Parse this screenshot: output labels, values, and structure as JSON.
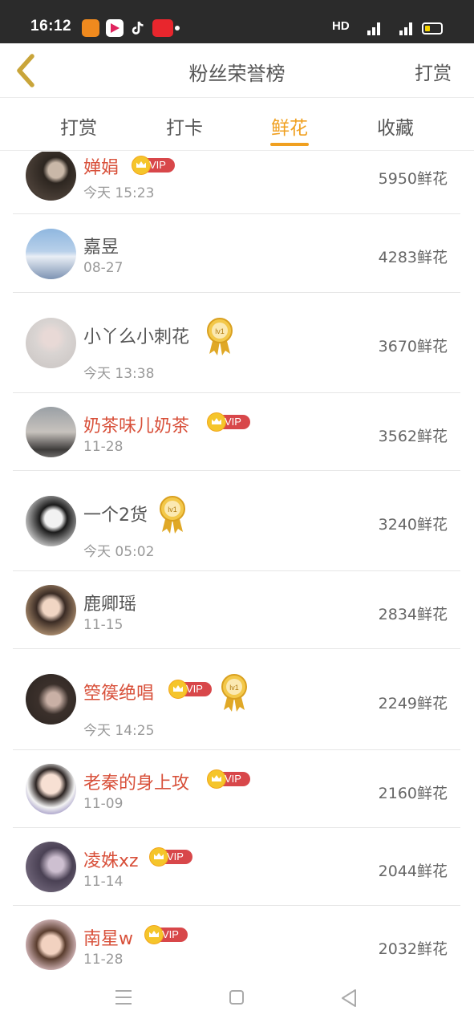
{
  "status_bar": {
    "time": "16:12",
    "network": "HD",
    "signal1": "4G",
    "signal2": "4G"
  },
  "header": {
    "title": "粉丝荣誉榜",
    "right_action": "打赏"
  },
  "tabs": [
    {
      "label": "打赏",
      "active": false
    },
    {
      "label": "打卡",
      "active": false
    },
    {
      "label": "鲜花",
      "active": true
    },
    {
      "label": "收藏",
      "active": false
    }
  ],
  "vip_label": "VIP",
  "medal_label": "lv1",
  "list": [
    {
      "name": "婵娟",
      "date": "今天 15:23",
      "value": "5950鲜花",
      "vip": true,
      "medal": false
    },
    {
      "name": "嘉昱",
      "date": "08-27",
      "value": "4283鲜花",
      "vip": false,
      "medal": false
    },
    {
      "name": "小丫么小刺花",
      "date": "今天 13:38",
      "value": "3670鲜花",
      "vip": false,
      "medal": true
    },
    {
      "name": "奶茶味儿奶茶",
      "date": "11-28",
      "value": "3562鲜花",
      "vip": true,
      "medal": false
    },
    {
      "name": "一个2货",
      "date": "今天 05:02",
      "value": "3240鲜花",
      "vip": false,
      "medal": true
    },
    {
      "name": "鹿卿瑶",
      "date": "11-15",
      "value": "2834鲜花",
      "vip": false,
      "medal": false
    },
    {
      "name": "箜篌绝唱",
      "date": "今天 14:25",
      "value": "2249鲜花",
      "vip": true,
      "medal": true
    },
    {
      "name": "老秦的身上攻",
      "date": "11-09",
      "value": "2160鲜花",
      "vip": true,
      "medal": false
    },
    {
      "name": "凌姝xz",
      "date": "11-14",
      "value": "2044鲜花",
      "vip": true,
      "medal": false
    },
    {
      "name": "南星w",
      "date": "11-28",
      "value": "2032鲜花",
      "vip": true,
      "medal": false
    }
  ],
  "colors": {
    "accent": "#f0a020",
    "vip_name": "#d8503a",
    "vip_badge": "#d8474a",
    "status_bar": "#2b2b2b"
  }
}
